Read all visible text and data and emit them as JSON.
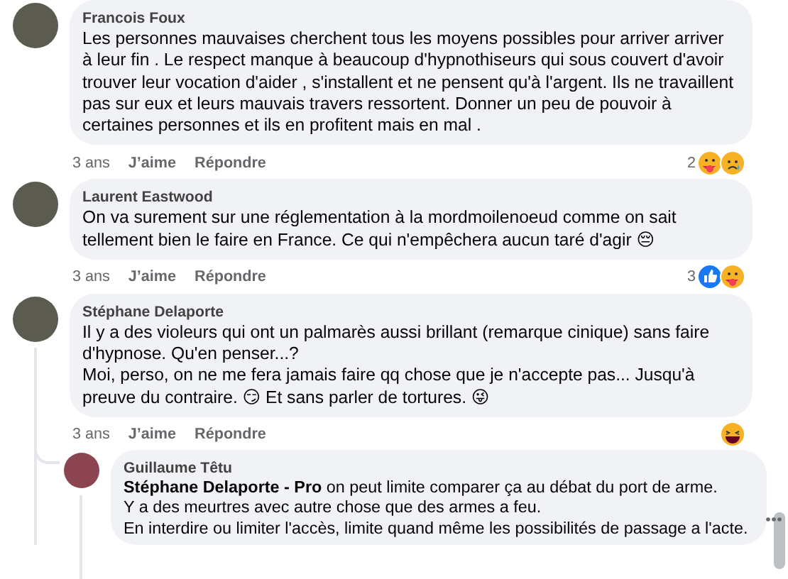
{
  "comments": [
    {
      "author": "Francois Foux",
      "paragraphs": [
        "Les personnes mauvaises cherchent tous les moyens possibles pour arriver arriver à leur fin . Le respect manque à beaucoup d'hypnothiseurs qui sous couvert d'avoir trouver leur vocation d'aider , s'installent et ne pensent qu'à l'argent. Ils ne travaillent pas sur eux et leurs mauvais travers ressortent. Donner un peu de pouvoir à certaines personnes et ils en profitent mais en mal ."
      ],
      "time": "3 ans",
      "like": "J’aime",
      "reply": "Répondre",
      "reaction_count": "2",
      "reactions": [
        {
          "kind": "care"
        },
        {
          "kind": "sad"
        }
      ]
    },
    {
      "author": "Laurent Eastwood",
      "paragraphs": [
        "On va surement sur une réglementation à la mordmoilenoeud comme on sait tellement bien le faire en France. Ce qui n'empêchera aucun taré d'agir 😔"
      ],
      "time": "3 ans",
      "like": "J’aime",
      "reply": "Répondre",
      "reaction_count": "3",
      "reactions": [
        {
          "kind": "like"
        },
        {
          "kind": "care"
        }
      ]
    },
    {
      "author": "Stéphane Delaporte",
      "paragraphs": [
        "Il y a des violeurs qui ont un palmarès aussi brillant (remarque cinique) sans faire d'hypnose. Qu'en penser...?",
        "Moi, perso, on ne me fera jamais faire qq chose que je n'accepte pas... Jusqu'à preuve du contraire. 😏 Et sans parler de tortures. 😜"
      ],
      "time": "3 ans",
      "like": "J’aime",
      "reply": "Répondre",
      "reactions": [
        {
          "kind": "haha"
        }
      ],
      "replies": [
        {
          "author": "Guillaume Têtu",
          "paragraphs": [
            "**Stéphane Delaporte - Pro** on peut limite comparer ça au débat du port de arme.",
            "Y a des meurtres avec autre chose que des armes a feu.",
            "En interdire ou limiter l'accès, limite quand même les possibilités de passage a l'acte."
          ]
        }
      ]
    }
  ]
}
